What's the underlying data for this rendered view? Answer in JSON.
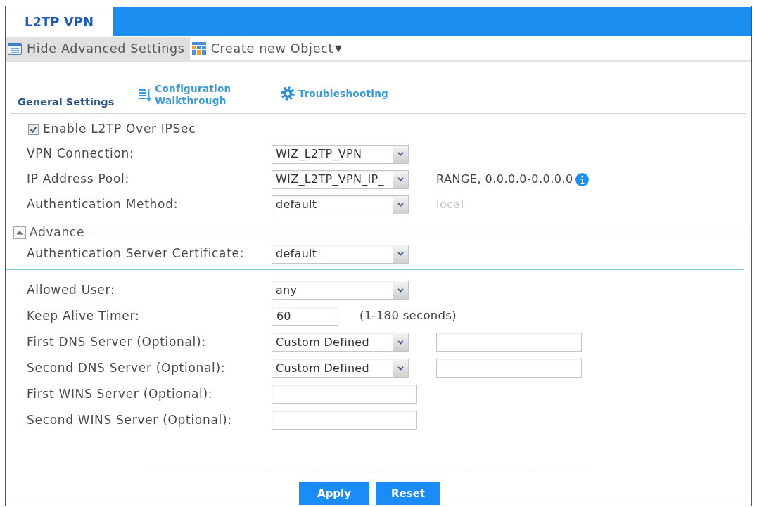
{
  "tabs": [
    {
      "label": "L2TP VPN",
      "selected": true
    }
  ],
  "toolbar": [
    {
      "kind": "toggle",
      "label": "Hide Advanced Settings",
      "selected": true
    },
    {
      "kind": "create",
      "label": "Create new Object",
      "arrow": "▼",
      "selected": false
    }
  ],
  "section": {
    "title": "General Settings",
    "links": [
      {
        "kind": "walkthrough",
        "label": "Configuration Walkthrough"
      },
      {
        "kind": "troubleshoot",
        "label": "Troubleshooting"
      }
    ]
  },
  "fields": [
    {
      "kind": "checkbox",
      "label": "Enable L2TP Over IPSec",
      "checked": true
    },
    {
      "kind": "select",
      "label": "VPN Connection:",
      "value": "WIZ_L2TP_VPN"
    },
    {
      "kind": "select",
      "label": "IP Address Pool:",
      "value": "WIZ_L2TP_VPN_IP_",
      "note": {
        "kind": "info",
        "text": "RANGE, 0.0.0.0-0.0.0.0"
      }
    },
    {
      "kind": "select",
      "label": "Authentication Method:",
      "value": "default",
      "note": {
        "kind": "muted",
        "text": "local"
      }
    },
    {
      "kind": "group",
      "legend": "Advance",
      "expanded": true,
      "children": [
        {
          "kind": "select",
          "label": "Authentication Server Certificate:",
          "value": "default"
        }
      ]
    },
    {
      "kind": "select",
      "label": "Allowed User:",
      "value": "any"
    },
    {
      "kind": "number",
      "label": "Keep Alive Timer:",
      "value": "60",
      "suffix": "(1-180 seconds)"
    },
    {
      "kind": "selectfield",
      "label": "First DNS Server (Optional):",
      "value": "Custom Defined"
    },
    {
      "kind": "selectfield",
      "label": "Second DNS Server (Optional):",
      "value": "Custom Defined"
    },
    {
      "kind": "text",
      "label": "First WINS Server (Optional):"
    },
    {
      "kind": "text",
      "label": "Second WINS Server (Optional):"
    }
  ],
  "buttons": [
    {
      "label": "Apply"
    },
    {
      "label": "Reset"
    }
  ]
}
